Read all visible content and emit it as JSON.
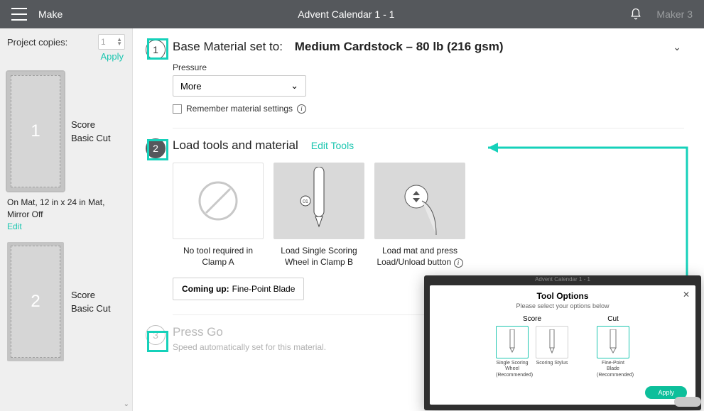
{
  "topbar": {
    "make": "Make",
    "title": "Advent Calendar 1 - 1",
    "device": "Maker 3"
  },
  "sidebar": {
    "copies_label": "Project copies:",
    "copies_value": "1",
    "apply": "Apply",
    "mats": [
      {
        "num": "1",
        "lines": [
          "Score",
          "Basic Cut"
        ],
        "info": "On Mat, 12 in x 24 in Mat, Mirror Off",
        "edit": "Edit"
      },
      {
        "num": "2",
        "lines": [
          "Score",
          "Basic Cut"
        ]
      }
    ]
  },
  "step1": {
    "title_prefix": "Base Material set to:",
    "material": "Medium Cardstock – 80 lb (216 gsm)",
    "pressure_label": "Pressure",
    "pressure_value": "More",
    "remember": "Remember material settings"
  },
  "step2": {
    "title": "Load tools and material",
    "edit": "Edit Tools",
    "cards": [
      "No tool required in Clamp A",
      "Load Single Scoring Wheel in Clamp B",
      "Load mat and press Load/Unload button"
    ],
    "coming_label": "Coming up:",
    "coming_value": "Fine-Point Blade"
  },
  "step3": {
    "title": "Press Go",
    "sub": "Speed automatically set for this material."
  },
  "popup": {
    "bg_title": "Advent Calendar 1 - 1",
    "title": "Tool Options",
    "sub": "Please select your options below",
    "score_h": "Score",
    "cut_h": "Cut",
    "opts": {
      "score1": "Single Scoring Wheel (Recommended)",
      "score2": "Scoring Stylus",
      "cut1": "Fine-Point Blade (Recommended)"
    },
    "apply": "Apply"
  }
}
